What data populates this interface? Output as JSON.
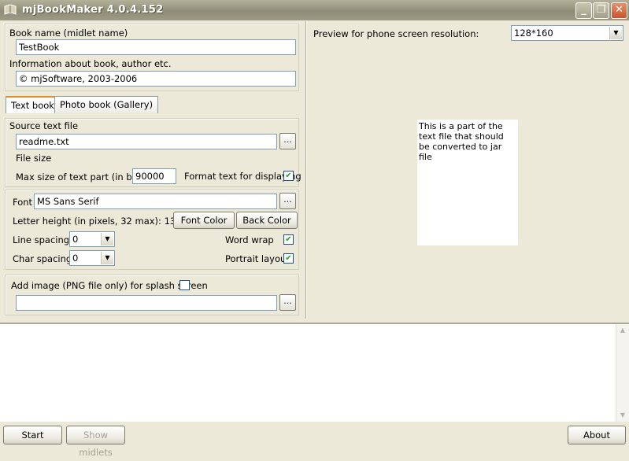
{
  "window": {
    "title": "mjBookMaker 4.0.4.152"
  },
  "book": {
    "name_label": "Book name (midlet name)",
    "name_value": "TestBook",
    "info_label": "Information about book, author etc.",
    "info_value": "© mjSoftware, 2003-2006"
  },
  "tabs": [
    {
      "label": "Text book",
      "active": true
    },
    {
      "label": "Photo book (Gallery)",
      "active": false
    }
  ],
  "source": {
    "label": "Source text file",
    "value": "readme.txt",
    "browse": "...",
    "file_size_label": "File size",
    "max_size_label": "Max size of text part (in bytes)",
    "max_size_value": "90000",
    "format_label": "Format text for displaying",
    "format_checked": "✔"
  },
  "font": {
    "label": "Font",
    "value": "MS Sans Serif",
    "browse": "...",
    "letter_height": "Letter height (in pixels, 32 max): 13",
    "font_color_btn": "Font Color",
    "back_color_btn": "Back Color",
    "line_spacing_label": "Line spacing",
    "line_spacing_value": "0",
    "char_spacing_label": "Char spacing",
    "char_spacing_value": "0",
    "word_wrap_label": "Word wrap",
    "word_wrap_checked": "✔",
    "portrait_label": "Portrait layout",
    "portrait_checked": "✔"
  },
  "splash": {
    "label": "Add image (PNG file only) for splash screen",
    "value": "",
    "browse": "..."
  },
  "preview": {
    "label": "Preview  for phone screen resolution:",
    "resolution": "128*160",
    "text": "This is a part of the text file that should be converted to jar file"
  },
  "bottom": {
    "start": "Start",
    "show_midlets": "Show midlets",
    "about": "About"
  }
}
